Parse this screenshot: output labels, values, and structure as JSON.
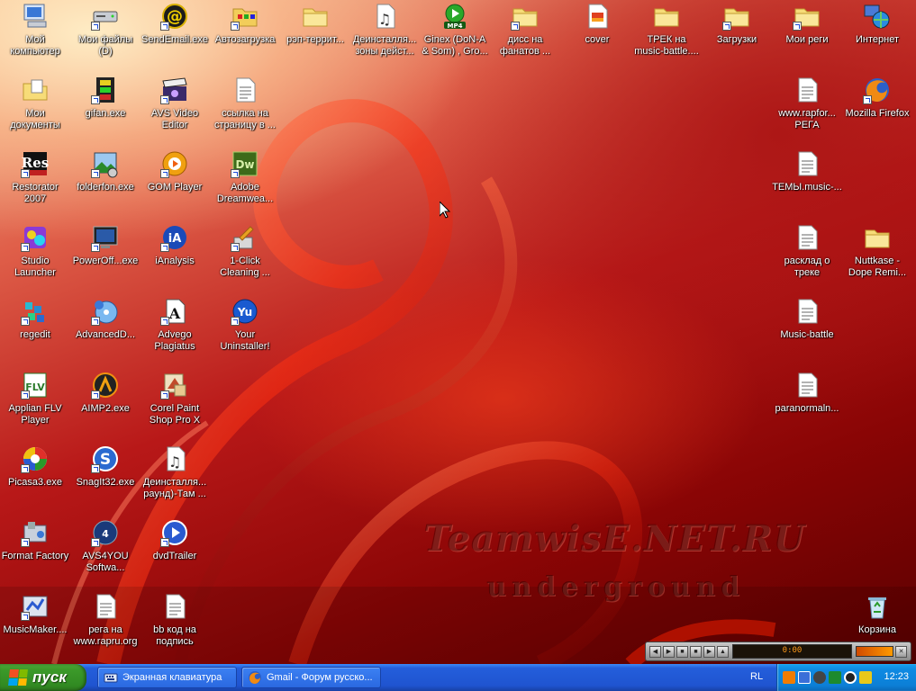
{
  "desktop_icons": [
    {
      "label": "Мой компьютер",
      "icon": "computer-icon",
      "shortcut": false
    },
    {
      "label": "Мои файлы (D)",
      "icon": "drive-icon",
      "shortcut": true
    },
    {
      "label": "SendEmail.exe",
      "icon": "email-at-icon",
      "shortcut": true
    },
    {
      "label": "Автозагрузка",
      "icon": "folder-programs-icon",
      "shortcut": true
    },
    {
      "label": "рэп-террит...",
      "icon": "folder-icon",
      "shortcut": false
    },
    {
      "label": "Деинсталля... зоны дейст...",
      "icon": "mp3-note-icon",
      "shortcut": false
    },
    {
      "label": "Ginex (DoN-A & Som) , Gro...",
      "icon": "mp4-icon",
      "shortcut": false
    },
    {
      "label": "дисс на фанатов ...",
      "icon": "folder-icon",
      "shortcut": true
    },
    {
      "label": "cover",
      "icon": "image-file-icon",
      "shortcut": false
    },
    {
      "label": "ТРЕК на music-battle....",
      "icon": "folder-icon",
      "shortcut": false
    },
    {
      "label": "Загрузки",
      "icon": "folder-icon",
      "shortcut": true
    },
    {
      "label": "Мои реги",
      "icon": "folder-icon",
      "shortcut": true
    },
    {
      "label": "Интернет",
      "icon": "internet-globe-icon",
      "shortcut": false
    },
    {
      "label": "Мои документы",
      "icon": "my-documents-icon",
      "shortcut": false
    },
    {
      "label": "gifan.exe",
      "icon": "film-icon",
      "shortcut": true
    },
    {
      "label": "AVS Video Editor",
      "icon": "clapper-icon",
      "shortcut": true
    },
    {
      "label": "ссылка на страницу в ...",
      "icon": "text-file-icon",
      "shortcut": false
    },
    {
      "label": "www.rapfor... РЕГА",
      "icon": "text-file-icon",
      "shortcut": false
    },
    {
      "label": "Mozilla Firefox",
      "icon": "firefox-icon",
      "shortcut": true
    },
    {
      "label": "Restorator 2007",
      "icon": "res-icon",
      "shortcut": true
    },
    {
      "label": "folderfon.exe",
      "icon": "picture-app-icon",
      "shortcut": true
    },
    {
      "label": "GOM Player",
      "icon": "gom-icon",
      "shortcut": true
    },
    {
      "label": "Adobe Dreamwea...",
      "icon": "dreamweaver-icon",
      "shortcut": true
    },
    {
      "label": "ТЕМЫ.music-...",
      "icon": "text-file-icon",
      "shortcut": false
    },
    {
      "label": "Studio Launcher",
      "icon": "studio-icon",
      "shortcut": true
    },
    {
      "label": "PowerOff...exe",
      "icon": "monitor-app-icon",
      "shortcut": true
    },
    {
      "label": "iAnalysis",
      "icon": "ianalysis-icon",
      "shortcut": true
    },
    {
      "label": "1-Click Cleaning ...",
      "icon": "cleaning-icon",
      "shortcut": true
    },
    {
      "label": "расклад о треке",
      "icon": "text-file-icon",
      "shortcut": false
    },
    {
      "label": "Nuttkase - Dope Remi...",
      "icon": "folder-icon",
      "shortcut": false
    },
    {
      "label": "regedit",
      "icon": "regedit-icon",
      "shortcut": true
    },
    {
      "label": "AdvancedD...",
      "icon": "disc-icon",
      "shortcut": true
    },
    {
      "label": "Advego Plagiatus",
      "icon": "advego-icon",
      "shortcut": true
    },
    {
      "label": "Your Uninstaller!",
      "icon": "uninstaller-icon",
      "shortcut": true
    },
    {
      "label": "Music-battle",
      "icon": "text-file-icon",
      "shortcut": false
    },
    {
      "label": "Applian FLV Player",
      "icon": "flv-icon",
      "shortcut": true
    },
    {
      "label": "AIMP2.exe",
      "icon": "aimp-icon",
      "shortcut": true
    },
    {
      "label": "Corel Paint Shop Pro X",
      "icon": "corel-icon",
      "shortcut": true
    },
    {
      "label": "paranormaln...",
      "icon": "text-file-icon",
      "shortcut": false
    },
    {
      "label": "Picasa3.exe",
      "icon": "picasa-icon",
      "shortcut": true
    },
    {
      "label": "SnagIt32.exe",
      "icon": "snagit-icon",
      "shortcut": true
    },
    {
      "label": "Деинсталля... раунд)-Там ...",
      "icon": "mp3-note-icon",
      "shortcut": false
    },
    {
      "label": "Format Factory",
      "icon": "format-factory-icon",
      "shortcut": true
    },
    {
      "label": "AVS4YOU Softwa...",
      "icon": "avs4you-icon",
      "shortcut": true
    },
    {
      "label": "dvdTrailer",
      "icon": "dvd-icon",
      "shortcut": true
    },
    {
      "label": "MusicMaker....",
      "icon": "musicmaker-icon",
      "shortcut": true
    },
    {
      "label": "рега на www.rapru.org",
      "icon": "text-file-icon",
      "shortcut": false
    },
    {
      "label": "bb код на подпись",
      "icon": "text-file-icon",
      "shortcut": false
    },
    {
      "label": "Корзина",
      "icon": "recycle-bin-icon",
      "shortcut": false
    }
  ],
  "watermark": {
    "line1": "TeamwisE.NET.RU",
    "line2": "underground"
  },
  "player": {
    "time": "0:00"
  },
  "taskbar": {
    "start_label": "пуск",
    "tasks": [
      {
        "label": "Экранная клавиатура",
        "icon": "keyboard-icon"
      },
      {
        "label": "Gmail - Форум русско...",
        "icon": "firefox-icon"
      }
    ],
    "language": "RL",
    "clock": "12:23"
  },
  "colors": {
    "taskbar": "#245edb",
    "start": "#3c9a2a",
    "tray": "#0e8ae3"
  }
}
